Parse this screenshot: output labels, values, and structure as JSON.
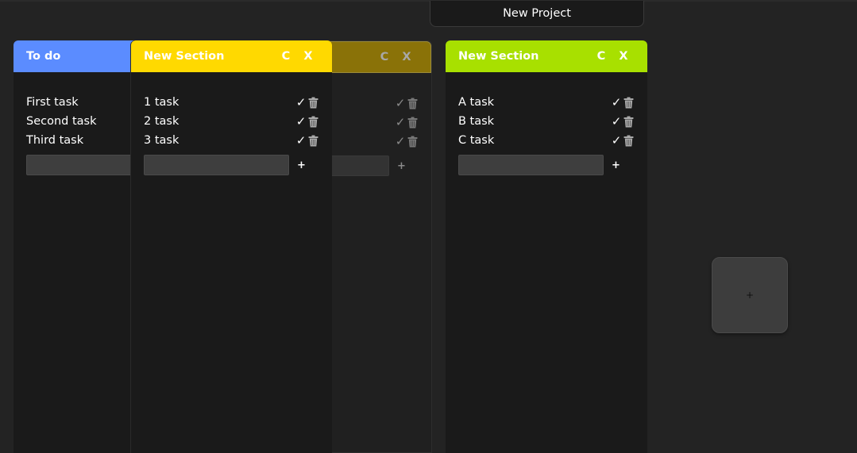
{
  "project": {
    "title": "New Project"
  },
  "columns": [
    {
      "title": "To do",
      "color": "#5b8cff",
      "tasks": [
        "First task",
        "Second task",
        "Third task"
      ]
    },
    {
      "title": "New Section",
      "color": "#ffd900",
      "clear_label": "C",
      "close_label": "X",
      "tasks": [
        "1 task",
        "2 task",
        "3 task"
      ],
      "add_label": "+"
    },
    {
      "title": "",
      "color": "#8a7208",
      "clear_label": "C",
      "close_label": "X",
      "add_label": "+"
    },
    {
      "title": "New Section",
      "color": "#a8e000",
      "clear_label": "C",
      "close_label": "X",
      "tasks": [
        "A task",
        "B task",
        "C task"
      ],
      "add_label": "+"
    }
  ],
  "icons": {
    "complete": "check-icon",
    "delete": "trash-icon"
  },
  "check_glyph": "✓",
  "add_section_label": "+"
}
